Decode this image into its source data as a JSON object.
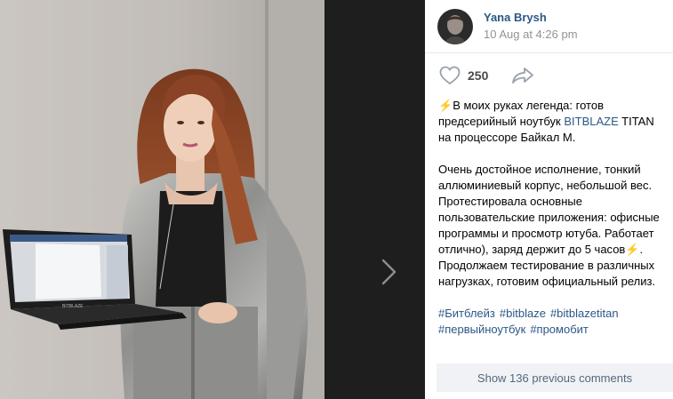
{
  "author": {
    "name": "Yana Brysh",
    "date": "10 Aug at 4:26 pm"
  },
  "actions": {
    "like_count": "250"
  },
  "post": {
    "p1_emoji": "⚡",
    "p1_text_a": "В моих руках легенда: готов предсерийный ноутбук ",
    "p1_link": "BITBLAZE",
    "p1_text_b": " TITAN на процессоре Байкал М.",
    "p2_text": "Очень достойное исполнение, тонкий аллюминиевый корпус, небольшой вес. Протестировала основные пользовательские приложения: офисные программы и просмотр ютуба. Работает отлично), заряд держит до 5 часов",
    "p2_emoji": "⚡",
    "p2_tail": ". Продолжаем тестирование в различных нагрузках, готовим официальный релиз.",
    "hashtags": [
      "#Битблейз",
      "#bitblaze",
      "#bitblazetitan",
      "#первыйноутбук",
      "#промобит"
    ]
  },
  "laptop_brand": "BITBLAZE",
  "comments": {
    "button_label": "Show 136 previous comments"
  },
  "icons": {
    "like": "heart-icon",
    "share": "share-arrow-icon",
    "next": "chevron-right-icon"
  },
  "colors": {
    "link": "#2a5885",
    "date": "#939393",
    "comments_bg": "#f0f2f5",
    "comments_text": "#55677d"
  }
}
